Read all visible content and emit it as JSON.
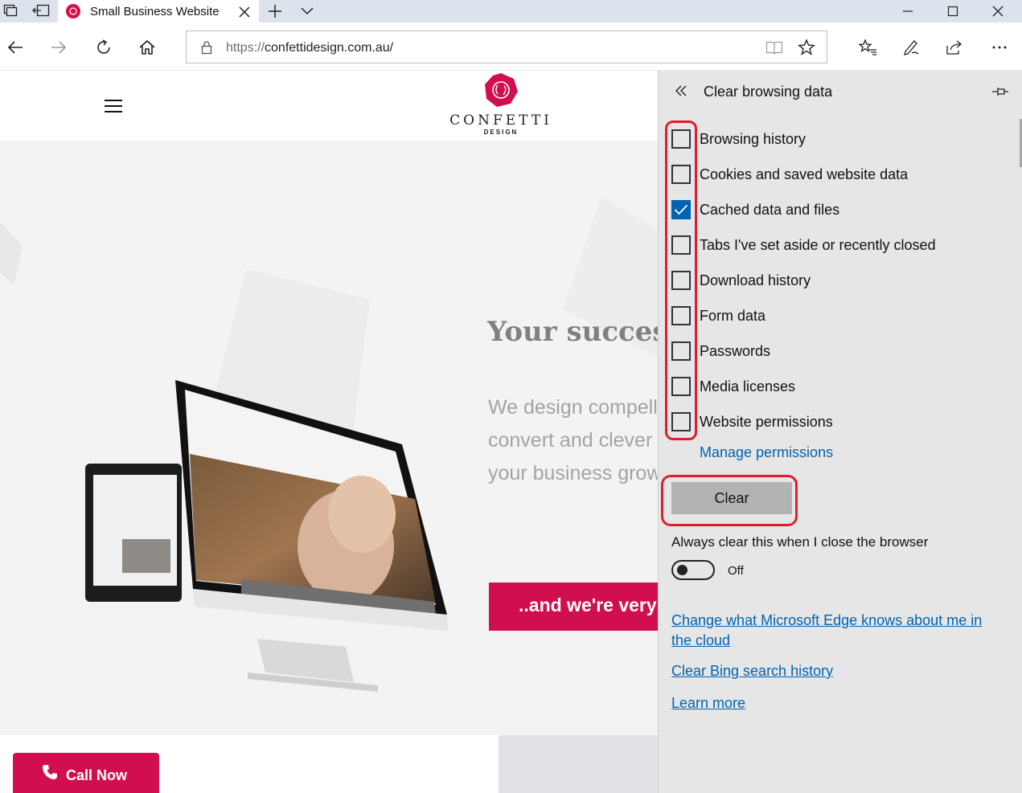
{
  "browser": {
    "tab": {
      "title": "Small Business Website"
    },
    "address": {
      "protocol": "https://",
      "host": "confettidesign.com.au/"
    }
  },
  "site": {
    "logo": {
      "wordmark": "CONFETTI",
      "sub": "DESIGN"
    },
    "hero": {
      "title": "Your succes",
      "text_lines": [
        "We design compell",
        "convert and clever",
        "your business grow"
      ],
      "cta": "..and we're very"
    },
    "call_button": "Call Now"
  },
  "panel": {
    "title": "Clear browsing data",
    "options": [
      {
        "label": "Browsing history",
        "checked": false
      },
      {
        "label": "Cookies and saved website data",
        "checked": false
      },
      {
        "label": "Cached data and files",
        "checked": true
      },
      {
        "label": "Tabs I've set aside or recently closed",
        "checked": false
      },
      {
        "label": "Download history",
        "checked": false
      },
      {
        "label": "Form data",
        "checked": false
      },
      {
        "label": "Passwords",
        "checked": false
      },
      {
        "label": "Media licenses",
        "checked": false
      },
      {
        "label": "Website permissions",
        "checked": false
      }
    ],
    "manage_permissions": "Manage permissions",
    "clear_button": "Clear",
    "always_clear_label": "Always clear this when I close the browser",
    "toggle_state": "Off",
    "links": {
      "edge_cloud_line1": "Change what Microsoft Edge knows about me in",
      "edge_cloud_line2": "the cloud",
      "bing": "Clear Bing search history",
      "learn": "Learn more"
    }
  },
  "colors": {
    "brand": "#d10f4f",
    "accent": "#0063b1",
    "highlight": "#e21d2b",
    "panel_bg": "#e6e6e6"
  }
}
